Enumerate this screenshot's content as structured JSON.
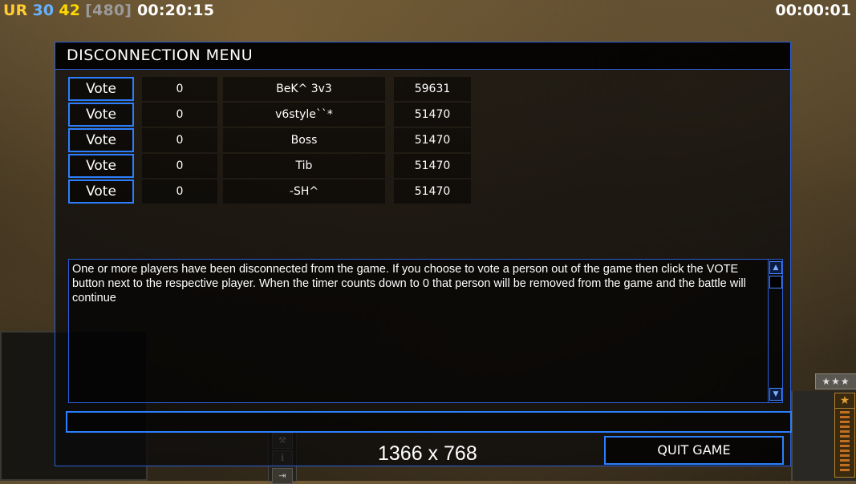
{
  "hud": {
    "faction": "UR",
    "power": "30",
    "units": "42",
    "max_units": "[480]",
    "game_time": "00:20:15",
    "timer": "00:00:01",
    "rank_stars": "★★★"
  },
  "dialog": {
    "title": "DISCONNECTION MENU",
    "vote_label": "Vote",
    "players": [
      {
        "votes": "0",
        "name": "BeK^ 3v3",
        "score": "59631"
      },
      {
        "votes": "0",
        "name": "v6style``*",
        "score": "51470"
      },
      {
        "votes": "0",
        "name": "Boss",
        "score": "51470"
      },
      {
        "votes": "0",
        "name": "Tib",
        "score": "51470"
      },
      {
        "votes": "0",
        "name": "-SH^",
        "score": "51470"
      }
    ],
    "message": "One or more players have been disconnected from the game. If you choose to vote a person out of the game then click the VOTE button next to the respective player. When the timer counts down to 0 that person will be removed from the game and the battle will continue",
    "chat_value": "",
    "quit_label": "QUIT GAME"
  },
  "overlay": {
    "resolution": "1366 x 768"
  },
  "colors": {
    "accent": "#2b7fff",
    "border": "#2b5fd9"
  }
}
